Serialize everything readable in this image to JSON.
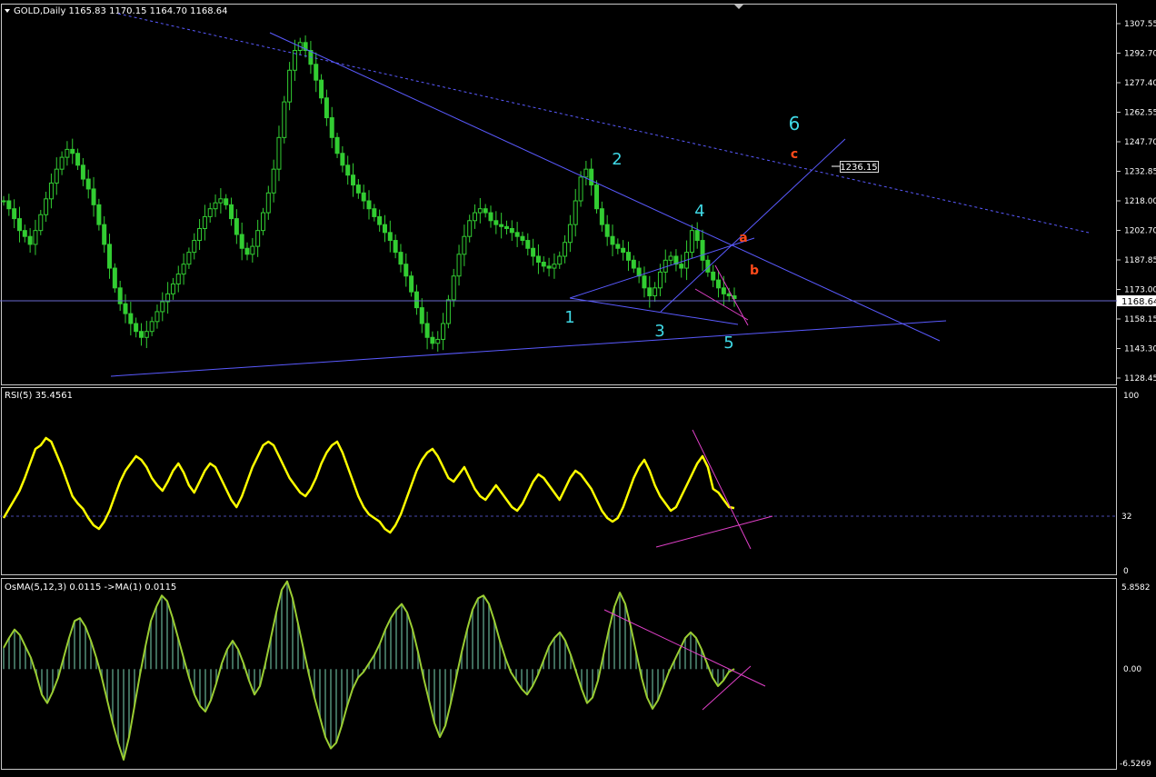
{
  "colors": {
    "background": "#000000",
    "frame": "#c8c8c8",
    "candles": "#32cd32",
    "trendline": "#5a5aff",
    "wave_label": "#3fd9e6",
    "abc_label": "#ff4a1a",
    "rsi_line": "#ffff00",
    "osma_hist": "#3e6b5a",
    "osma_line": "#9acd32",
    "pink": "#e040c8",
    "level_line": "#4a4ab0"
  },
  "main": {
    "header": "GOLD,Daily  1165.83 1170.15 1164.70 1168.64",
    "price_axis": [
      "1307.55",
      "1292.70",
      "1277.40",
      "1262.55",
      "1247.70",
      "1232.85",
      "1218.00",
      "1202.70",
      "1187.85",
      "1173.00",
      "1158.15",
      "1143.30",
      "1128.45"
    ],
    "current_price": "1168.64",
    "target_price": "1236.15",
    "wave_labels": [
      "1",
      "2",
      "3",
      "4",
      "5",
      "6"
    ],
    "abc_labels": [
      "a",
      "b",
      "c"
    ]
  },
  "rsi": {
    "header": "RSI(5) 35.4561",
    "axis": [
      "100",
      "32",
      "0"
    ]
  },
  "osma": {
    "header": "OsMA(5,12,3) 0.0115  ->MA(1) 0.0115",
    "axis": [
      "5.8582",
      "0.00",
      "-6.5269"
    ]
  },
  "chart_data": {
    "type": "line",
    "symbol": "GOLD",
    "timeframe": "Daily",
    "ohlc_last": {
      "open": 1165.83,
      "high": 1170.15,
      "low": 1164.7,
      "close": 1168.64
    },
    "ylim": [
      1128.45,
      1307.55
    ],
    "close_series": [
      1218,
      1214,
      1209,
      1203,
      1200,
      1196,
      1203,
      1211,
      1219,
      1227,
      1234,
      1240,
      1244,
      1242,
      1236,
      1229,
      1224,
      1216,
      1206,
      1196,
      1184,
      1174,
      1166,
      1161,
      1156,
      1152,
      1149,
      1152,
      1157,
      1162,
      1167,
      1171,
      1176,
      1181,
      1186,
      1192,
      1198,
      1204,
      1210,
      1214,
      1217,
      1219,
      1216,
      1209,
      1201,
      1194,
      1191,
      1195,
      1203,
      1212,
      1222,
      1234,
      1250,
      1268,
      1284,
      1294,
      1298,
      1294,
      1287,
      1279,
      1270,
      1260,
      1250,
      1242,
      1236,
      1231,
      1226,
      1222,
      1218,
      1214,
      1210,
      1206,
      1202,
      1198,
      1192,
      1186,
      1180,
      1172,
      1164,
      1156,
      1149,
      1146,
      1148,
      1156,
      1168,
      1180,
      1191,
      1200,
      1208,
      1212,
      1214,
      1212,
      1208,
      1206,
      1205,
      1204,
      1202,
      1200,
      1198,
      1194,
      1190,
      1187,
      1185,
      1184,
      1186,
      1190,
      1197,
      1206,
      1218,
      1230,
      1234,
      1226,
      1214,
      1206,
      1200,
      1196,
      1194,
      1192,
      1188,
      1184,
      1180,
      1174,
      1170,
      1174,
      1182,
      1188,
      1190,
      1186,
      1184,
      1192,
      1203,
      1198,
      1188,
      1182,
      1178,
      1174,
      1171,
      1170,
      1168.64
    ],
    "wave_points": [
      {
        "label": "1",
        "price": 1170
      },
      {
        "label": "2",
        "price": 1233
      },
      {
        "label": "3",
        "price": 1165
      },
      {
        "label": "4",
        "price": 1205
      },
      {
        "label": "5",
        "price": 1161
      },
      {
        "label": "6",
        "price": 1236.15
      }
    ],
    "rsi": {
      "period": 5,
      "last": 35.4561,
      "level": 32,
      "ylim": [
        0,
        100
      ],
      "values": [
        30,
        35,
        40,
        45,
        52,
        60,
        68,
        70,
        74,
        72,
        65,
        58,
        50,
        42,
        38,
        35,
        30,
        26,
        24,
        28,
        34,
        42,
        50,
        56,
        60,
        64,
        62,
        58,
        52,
        48,
        45,
        50,
        56,
        60,
        55,
        48,
        44,
        50,
        56,
        60,
        58,
        52,
        46,
        40,
        36,
        42,
        50,
        58,
        64,
        70,
        72,
        70,
        64,
        58,
        52,
        48,
        44,
        42,
        46,
        52,
        60,
        66,
        70,
        72,
        66,
        58,
        50,
        42,
        36,
        32,
        30,
        28,
        24,
        22,
        26,
        32,
        40,
        48,
        56,
        62,
        66,
        68,
        64,
        58,
        52,
        50,
        54,
        58,
        52,
        46,
        42,
        40,
        44,
        48,
        44,
        40,
        36,
        34,
        38,
        44,
        50,
        54,
        52,
        48,
        44,
        40,
        46,
        52,
        56,
        54,
        50,
        46,
        40,
        34,
        30,
        28,
        30,
        36,
        44,
        52,
        58,
        62,
        56,
        48,
        42,
        38,
        34,
        36,
        42,
        48,
        54,
        60,
        64,
        58,
        46,
        44,
        40,
        36,
        35.4561
      ]
    },
    "osma": {
      "params": "5,12,3",
      "ma_period": 1,
      "last": 0.0115,
      "ylim": [
        -6.5269,
        5.8582
      ],
      "values": [
        1.5,
        2.2,
        2.8,
        2.4,
        1.6,
        0.8,
        -0.4,
        -1.8,
        -2.4,
        -1.6,
        -0.6,
        0.8,
        2.2,
        3.4,
        3.6,
        3.0,
        2.0,
        0.8,
        -0.6,
        -2.2,
        -3.8,
        -5.2,
        -6.4,
        -4.8,
        -2.6,
        -0.4,
        1.6,
        3.4,
        4.4,
        5.2,
        4.8,
        3.6,
        2.2,
        0.8,
        -0.6,
        -1.8,
        -2.6,
        -3.0,
        -2.2,
        -1.0,
        0.4,
        1.4,
        2.0,
        1.4,
        0.4,
        -0.8,
        -1.8,
        -1.2,
        0.4,
        2.2,
        4.0,
        5.6,
        6.2,
        5.0,
        3.2,
        1.4,
        -0.4,
        -2.0,
        -3.4,
        -4.8,
        -5.6,
        -5.2,
        -4.0,
        -2.6,
        -1.4,
        -0.6,
        -0.2,
        0.4,
        1.0,
        1.8,
        2.8,
        3.6,
        4.2,
        4.6,
        4.0,
        2.8,
        1.2,
        -0.6,
        -2.2,
        -3.8,
        -4.8,
        -4.0,
        -2.4,
        -0.6,
        1.2,
        2.8,
        4.2,
        5.0,
        5.2,
        4.6,
        3.4,
        2.0,
        0.8,
        -0.2,
        -0.8,
        -1.4,
        -1.8,
        -1.2,
        -0.4,
        0.6,
        1.6,
        2.2,
        2.6,
        2.0,
        1.0,
        -0.2,
        -1.4,
        -2.4,
        -2.0,
        -0.8,
        1.0,
        2.8,
        4.4,
        5.4,
        4.6,
        3.0,
        1.2,
        -0.6,
        -2.0,
        -2.8,
        -2.2,
        -1.2,
        -0.2,
        0.6,
        1.4,
        2.2,
        2.6,
        2.2,
        1.4,
        0.4,
        -0.6,
        -1.2,
        -0.8,
        -0.2,
        0.0115
      ]
    }
  }
}
